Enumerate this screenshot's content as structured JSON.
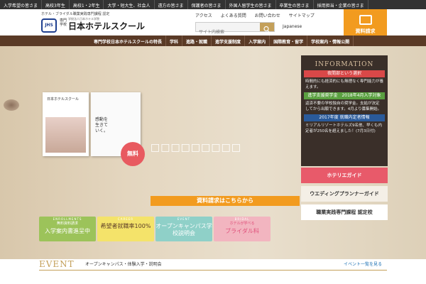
{
  "topbar": [
    "入学希望の皆さま",
    "高校3年生",
    "高校1・2年生",
    "大学・短大生、社会人",
    "遠方の皆さま",
    "保護者の皆さま",
    "外国人留学生の皆さま",
    "卒業生の皆さま",
    "採用担当・企業の皆さま"
  ],
  "header": {
    "tagline": "ホテル・ブライダル職業実践専門課程 認定",
    "logo_mark": "JHS",
    "logo_sub": "学校法人日本ホテル学院",
    "logo_small": "専門学校",
    "logo_text": "日本ホテルスクール",
    "nav": [
      "アクセス",
      "よくある質問",
      "お問い合わせ",
      "サイトマップ"
    ],
    "search_placeholder": "サイト内検索",
    "language": "Japanese",
    "request_label": "資料請求"
  },
  "mainnav": [
    "専門学校日本ホテルスクールの特長",
    "学科",
    "進路・就職",
    "進学支援制度",
    "入学案内",
    "国際教育・留学",
    "学校案内・情報公開"
  ],
  "hero": {
    "brochure1_title": "日本ホテルスクール",
    "brochure2_title": "感動を生きていく。",
    "free_badge": "無料",
    "banner_title": "□□□□□□□□□",
    "doc_link": "資料請求はこちらから"
  },
  "cards": [
    {
      "small": "ENROLLMENTS",
      "label": "入学案内書進呈中",
      "top": "無料資料請求",
      "bg": "#9cc35a",
      "fg": "#fff"
    },
    {
      "small": "CAREER",
      "label": "希望者就職率100%",
      "top": "",
      "bg": "#f4e36a",
      "fg": "#5a3a26"
    },
    {
      "small": "EVENT",
      "label": "オープンキャンパス学校説明会",
      "top": "",
      "bg": "#8fd0c8",
      "fg": "#fff"
    },
    {
      "small": "BRIDAL",
      "label": "ブライダル科",
      "top": "ホテルが学べる",
      "bg": "#f2b5c0",
      "fg": "#e0507a"
    }
  ],
  "info": {
    "heading": "INFORMATION",
    "items": [
      {
        "title": "夜間部という選択",
        "color": "#d94848",
        "text": "時間的にも経済的にも無理なく専門能力が養えます。"
      },
      {
        "title": "進学支援奨学金　2018年4月入学対象",
        "color": "#5aa040",
        "text": "返済不要の学校独自の奨学金。支給が決定してから出願できます。4月より募集開始。"
      },
      {
        "title": "2017年度 就職内定者情報",
        "color": "#2a5a9a",
        "text": "ミリアルリゾートホテルズ9名他、早くも内定者が250名を超えました！(7月3日付)"
      }
    ]
  },
  "side": [
    {
      "label": "ホテリエガイド",
      "bg": "#e85a6a"
    },
    {
      "label": "ウエディングプランナーガイド",
      "bg": "#f4efe6"
    },
    {
      "label": "職業実践専門課程 認定校",
      "bg": "#ffffff"
    }
  ],
  "event": {
    "title": "EVENT",
    "subtitle": "オープンキャンパス・体験入学・説明会",
    "more": "イベント一覧を見る"
  }
}
